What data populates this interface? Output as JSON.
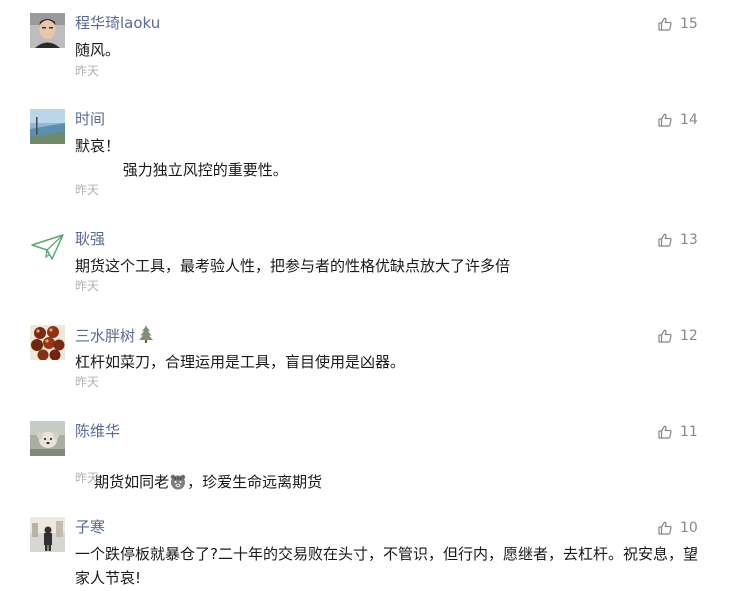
{
  "colors": {
    "name": "#576b95",
    "content": "#1a1a1a",
    "time": "#b2b2b2",
    "like": "#888888"
  },
  "comments": [
    {
      "name": "程华琦laoku",
      "content": "随风。",
      "time": "昨天",
      "likes": "15",
      "avatar_icon": "person-photo-icon"
    },
    {
      "name": "时间",
      "content": "默哀！\n          强力独立风控的重要性。",
      "time": "昨天",
      "likes": "14",
      "avatar_icon": "landscape-photo-icon"
    },
    {
      "name": "耿强",
      "content": "期货这个工具，最考验人性，把参与者的性格优缺点放大了许多倍",
      "time": "昨天",
      "likes": "13",
      "avatar_icon": "paper-plane-icon"
    },
    {
      "name": "三水胖树",
      "name_emoji": "christmas-tree-icon",
      "content": "杠杆如菜刀，合理运用是工具，盲目使用是凶器。",
      "time": "昨天",
      "likes": "12",
      "avatar_icon": "beads-photo-icon"
    },
    {
      "name": "陈维华",
      "content_before": "期货如同老",
      "content_emoji": "tiger-face-icon",
      "content_after": "，珍爱生命远离期货",
      "time": "昨天",
      "likes": "11",
      "avatar_icon": "dog-photo-icon"
    },
    {
      "name": "子寒",
      "content": "一个跌停板就暴仓了?二十年的交易败在头寸，不管识，但行内，愿继者，去杠杆。祝安息，望家人节哀!",
      "likes": "10",
      "avatar_icon": "person-street-photo-icon"
    }
  ]
}
